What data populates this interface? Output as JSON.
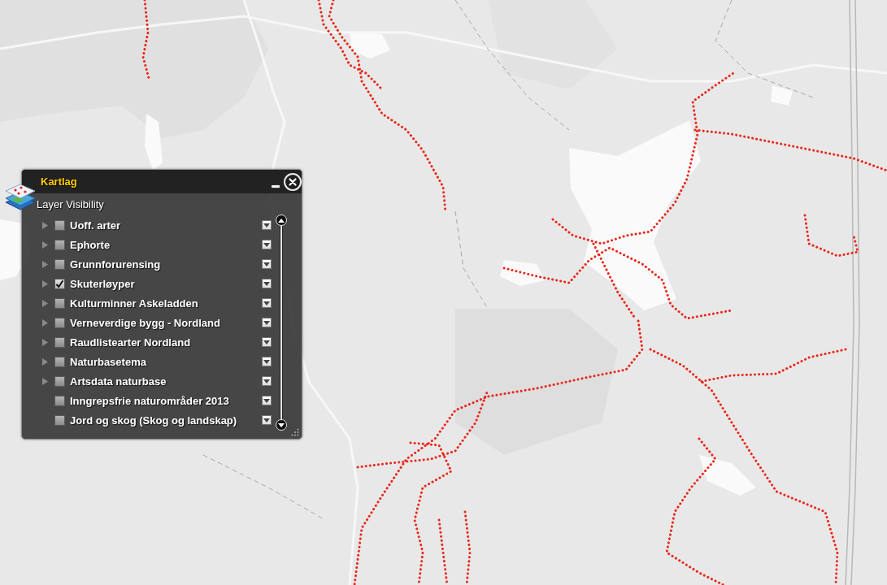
{
  "panel": {
    "title": "Kartlag",
    "subtitle": "Layer Visibility"
  },
  "layers": [
    {
      "name": "Uoff. arter",
      "kind": "group",
      "checked": false
    },
    {
      "name": "Ephorte",
      "kind": "group",
      "checked": false
    },
    {
      "name": "Grunnforurensing",
      "kind": "group",
      "checked": false
    },
    {
      "name": "Skuterløyper",
      "kind": "group",
      "checked": true
    },
    {
      "name": "Kulturminner Askeladden",
      "kind": "group",
      "checked": false
    },
    {
      "name": "Verneverdige bygg - Nordland",
      "kind": "group",
      "checked": false
    },
    {
      "name": "Raudlistearter Nordland",
      "kind": "group",
      "checked": false
    },
    {
      "name": "Naturbasetema",
      "kind": "group",
      "checked": false
    },
    {
      "name": "Artsdata naturbase",
      "kind": "group",
      "checked": false
    },
    {
      "name": "Inngrepsfrie naturområder 2013",
      "kind": "layer",
      "checked": false
    },
    {
      "name": "Jord og skog (Skog og landskap)",
      "kind": "layer",
      "checked": false
    }
  ]
}
